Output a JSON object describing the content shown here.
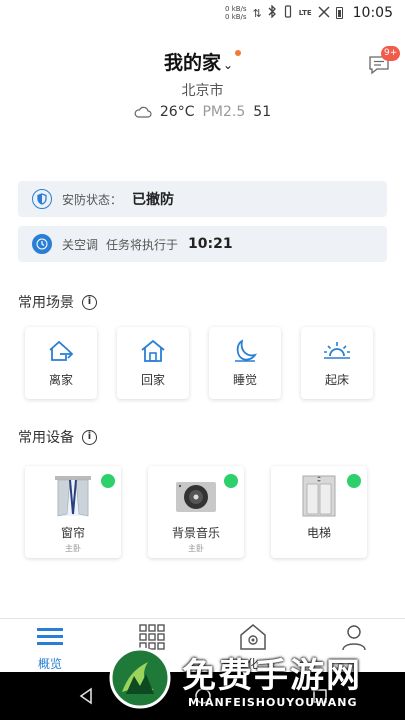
{
  "status_bar": {
    "net_up": "0 kB/s",
    "net_down": "0 kB/s",
    "signal_label": "LTE",
    "time": "10:05"
  },
  "header": {
    "home_name": "我的家",
    "chevron": "⌄",
    "message_badge": "9+",
    "city": "北京市",
    "temperature": "26°C",
    "pm_label": "PM2.5",
    "pm_value": "51"
  },
  "info_cards": {
    "security": {
      "label": "安防状态：",
      "value": "已撤防"
    },
    "ac_task": {
      "label": "关空调",
      "desc": "任务将执行于",
      "time": "10:21"
    }
  },
  "scenes": {
    "title": "常用场景",
    "items": [
      {
        "label": "离家",
        "icon": "leave-home-icon"
      },
      {
        "label": "回家",
        "icon": "home-icon"
      },
      {
        "label": "睡觉",
        "icon": "moon-icon"
      },
      {
        "label": "起床",
        "icon": "sunrise-icon"
      }
    ]
  },
  "devices": {
    "title": "常用设备",
    "items": [
      {
        "name": "窗帘",
        "room": "主卧",
        "status_color": "#2dd06b"
      },
      {
        "name": "背景音乐",
        "room": "主卧",
        "status_color": "#2dd06b"
      },
      {
        "name": "电梯",
        "room": "",
        "status_color": "#2dd06b"
      }
    ]
  },
  "bottom_nav": {
    "items": [
      {
        "label": "概览",
        "active": true
      },
      {
        "label": "",
        "active": false
      },
      {
        "label": "化",
        "active": false
      },
      {
        "label": "",
        "active": false
      }
    ]
  },
  "watermark": {
    "title": "免费手游网",
    "subtitle": "MIANFEISHOUYOUWANG"
  },
  "colors": {
    "accent": "#2a7fd4",
    "online": "#2dd06b",
    "badge": "#f25a4a",
    "card_bg": "#eef1f5"
  }
}
